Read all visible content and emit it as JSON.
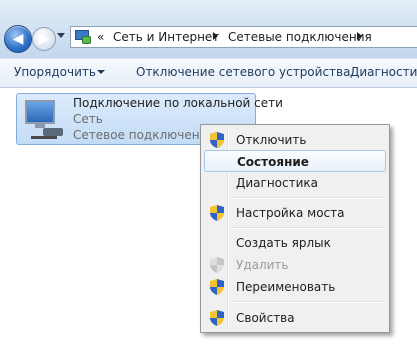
{
  "address": {
    "overflow": "«",
    "crumbs": [
      "Сеть и Интернет",
      "Сетевые подключения"
    ]
  },
  "toolbar": {
    "organize": "Упорядочить",
    "disable_device": "Отключение сетевого устройства",
    "diagnose": "Диагностика"
  },
  "connection": {
    "name": "Подключение по локальной сети",
    "network": "Сеть",
    "device": "Сетевое подключение I"
  },
  "context_menu": {
    "items": [
      {
        "label": "Отключить",
        "shield": true
      },
      {
        "label": "Состояние",
        "bold": true,
        "highlighted": true
      },
      {
        "label": "Диагностика"
      },
      {
        "label": "Настройка моста",
        "shield": true
      },
      {
        "label": "Создать ярлык"
      },
      {
        "label": "Удалить",
        "shield": true,
        "disabled": true
      },
      {
        "label": "Переименовать",
        "shield": true
      },
      {
        "label": "Свойства",
        "shield": true
      }
    ]
  },
  "colors": {
    "shield_blue": "#2f63c4",
    "shield_yellow": "#f3c431",
    "highlight_border": "#a8c8eb"
  }
}
